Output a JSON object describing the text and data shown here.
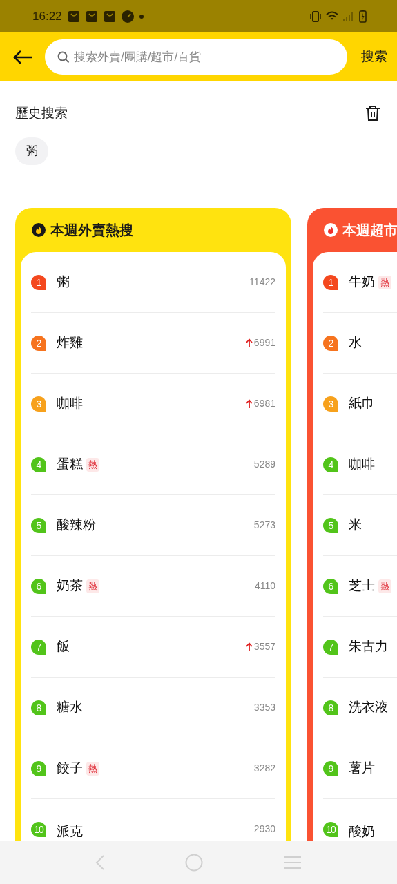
{
  "status_bar": {
    "time": "16:22"
  },
  "search": {
    "placeholder": "搜索外賣/團購/超市/百貨",
    "button": "搜索"
  },
  "history": {
    "title": "歷史搜索",
    "tags": [
      "粥"
    ]
  },
  "boards": [
    {
      "title": "本週外賣熱搜",
      "color": "#ffe30f",
      "items": [
        {
          "rank": "1",
          "color": "#f4481e",
          "label": "粥",
          "up": false,
          "count": "11422"
        },
        {
          "rank": "2",
          "color": "#f6731e",
          "label": "炸雞",
          "up": true,
          "count": "6991"
        },
        {
          "rank": "3",
          "color": "#f7a11c",
          "label": "咖啡",
          "up": true,
          "count": "6981"
        },
        {
          "rank": "4",
          "color": "#52c41a",
          "label": "蛋糕",
          "hot": "熱",
          "up": false,
          "count": "5289"
        },
        {
          "rank": "5",
          "color": "#52c41a",
          "label": "酸辣粉",
          "up": false,
          "count": "5273"
        },
        {
          "rank": "6",
          "color": "#52c41a",
          "label": "奶茶",
          "hot": "熱",
          "up": false,
          "count": "4110"
        },
        {
          "rank": "7",
          "color": "#52c41a",
          "label": "飯",
          "up": true,
          "count": "3557"
        },
        {
          "rank": "8",
          "color": "#52c41a",
          "label": "糖水",
          "up": false,
          "count": "3353"
        },
        {
          "rank": "9",
          "color": "#52c41a",
          "label": "餃子",
          "hot": "熱",
          "up": false,
          "count": "3282"
        },
        {
          "rank": "10",
          "color": "#52c41a",
          "label": "派克",
          "up": false,
          "count": "2930"
        }
      ]
    },
    {
      "title": "本週超市",
      "color": "#fa5232",
      "items": [
        {
          "rank": "1",
          "color": "#f4481e",
          "label": "牛奶",
          "hot": "熱"
        },
        {
          "rank": "2",
          "color": "#f6731e",
          "label": "水"
        },
        {
          "rank": "3",
          "color": "#f7a11c",
          "label": "紙巾"
        },
        {
          "rank": "4",
          "color": "#52c41a",
          "label": "咖啡"
        },
        {
          "rank": "5",
          "color": "#52c41a",
          "label": "米"
        },
        {
          "rank": "6",
          "color": "#52c41a",
          "label": "芝士",
          "hot": "熱"
        },
        {
          "rank": "7",
          "color": "#52c41a",
          "label": "朱古力"
        },
        {
          "rank": "8",
          "color": "#52c41a",
          "label": "洗衣液"
        },
        {
          "rank": "9",
          "color": "#52c41a",
          "label": "薯片"
        },
        {
          "rank": "10",
          "color": "#52c41a",
          "label": "酸奶"
        }
      ]
    }
  ]
}
